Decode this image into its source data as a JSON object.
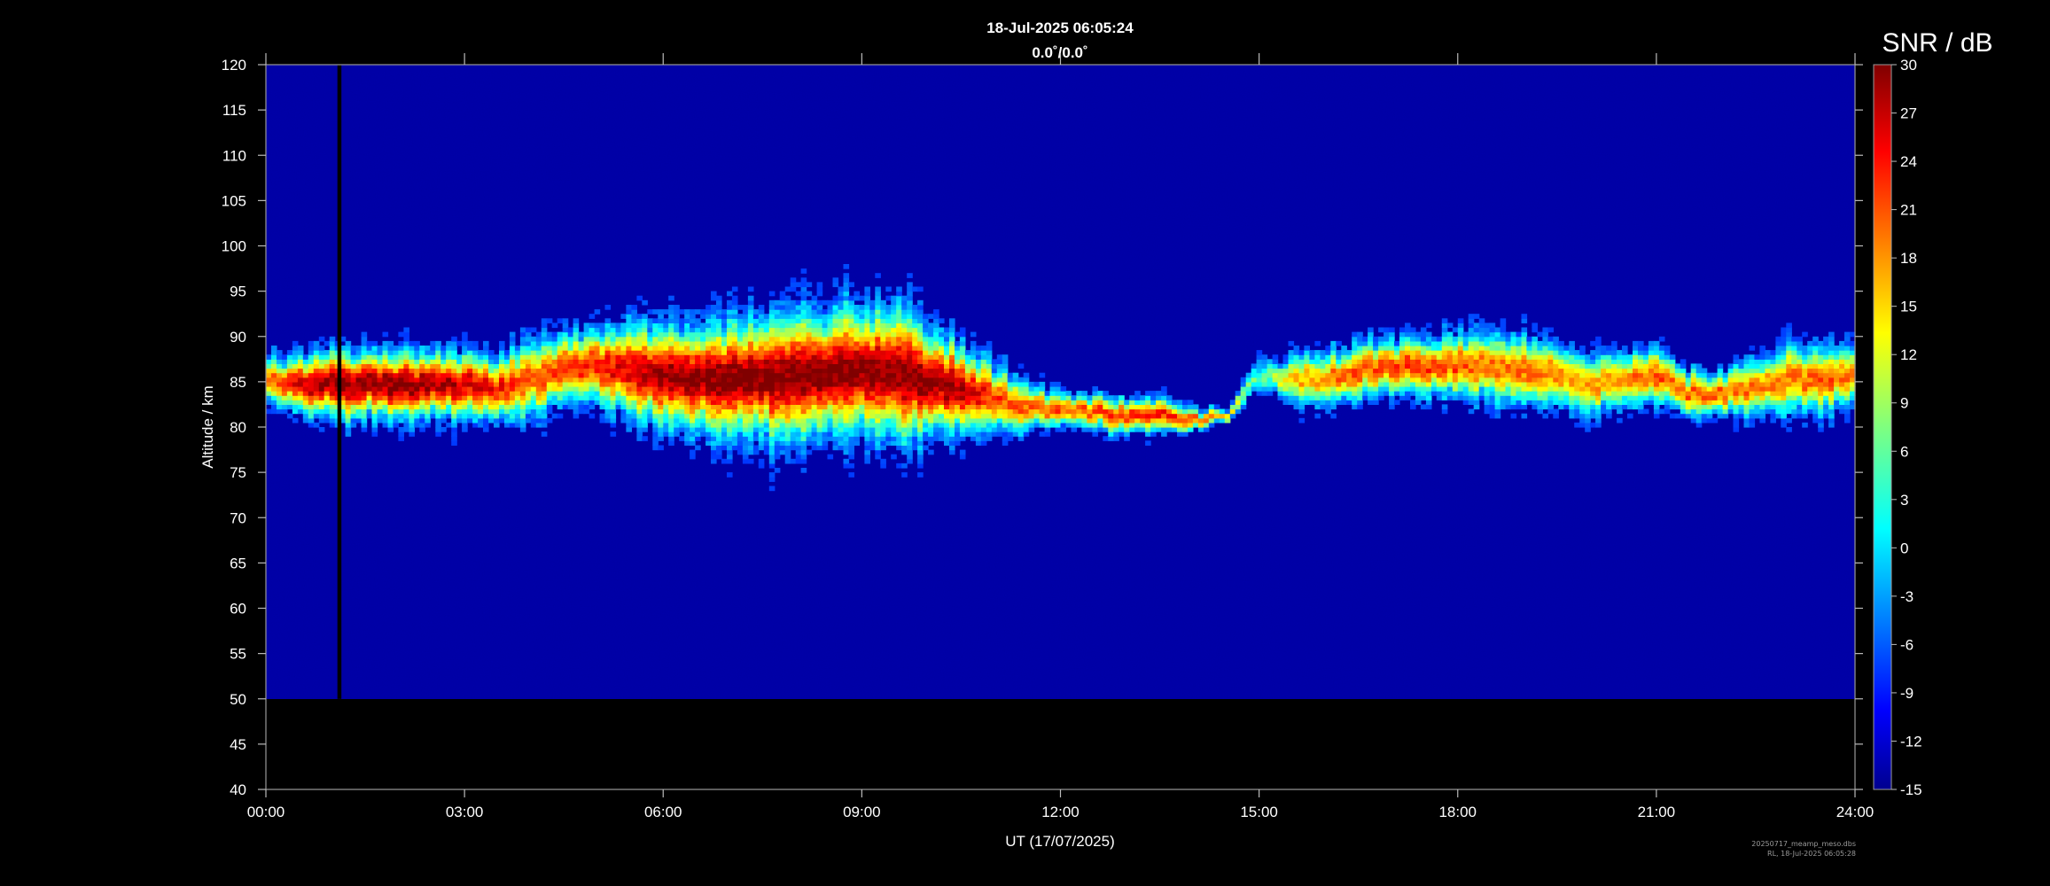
{
  "chart_data": {
    "type": "heatmap",
    "title": "18-Jul-2025 06:05:24",
    "subtitle": "0.0˚/0.0˚",
    "xlabel": "UT (17/07/2025)",
    "ylabel": "Altitude / km",
    "xlim": [
      "00:00",
      "24:00"
    ],
    "ylim": [
      40,
      120
    ],
    "x_ticks": [
      "00:00",
      "03:00",
      "06:00",
      "09:00",
      "12:00",
      "15:00",
      "18:00",
      "21:00",
      "24:00"
    ],
    "y_ticks": [
      "40",
      "45",
      "50",
      "55",
      "60",
      "65",
      "70",
      "75",
      "80",
      "85",
      "90",
      "95",
      "100",
      "105",
      "110",
      "115",
      "120"
    ],
    "data_altitude_range": [
      50,
      120
    ],
    "colorbar": {
      "label": "SNR / dB",
      "range": [
        -15,
        30
      ],
      "ticks": [
        "-15",
        "-12",
        "-9",
        "-6",
        "-3",
        "0",
        "3",
        "6",
        "9",
        "12",
        "15",
        "18",
        "21",
        "24",
        "27",
        "30"
      ],
      "colormap": "jet"
    },
    "background_snr": -11,
    "echo_layer": {
      "hours": [
        0,
        0.5,
        1,
        1.5,
        2,
        2.5,
        3,
        3.5,
        4,
        4.5,
        5,
        5.5,
        6,
        6.5,
        7,
        7.5,
        8,
        8.5,
        9,
        9.5,
        10,
        10.5,
        11,
        11.5,
        12,
        12.5,
        13,
        13.5,
        14,
        14.5,
        15,
        15.5,
        16,
        16.5,
        17,
        17.5,
        18,
        18.5,
        19,
        19.5,
        20,
        20.5,
        21,
        21.5,
        22,
        22.5,
        23,
        23.5,
        24
      ],
      "center_km": [
        85,
        84.5,
        84.5,
        84.5,
        84.5,
        84.5,
        84.5,
        84,
        85,
        86.5,
        86.5,
        86,
        85.5,
        85,
        85,
        85,
        85.5,
        85.5,
        86,
        85.5,
        85,
        84,
        83,
        82,
        81.5,
        81.5,
        81,
        81,
        80.5,
        81,
        85.5,
        85,
        85,
        86,
        86.5,
        86.5,
        86.5,
        86.5,
        86,
        85.5,
        84.5,
        85,
        85.5,
        83.5,
        83.5,
        84,
        85,
        85,
        85.5
      ],
      "half_width_km": [
        2,
        2.5,
        3,
        3,
        3,
        3,
        3,
        3,
        3.5,
        3,
        3.5,
        4,
        4.5,
        4.5,
        5,
        5.5,
        5.5,
        5.5,
        5.5,
        5.5,
        5,
        4,
        3,
        2,
        1.5,
        1.5,
        1.5,
        1.5,
        1,
        0.5,
        1.5,
        2,
        2.5,
        2.5,
        2.5,
        2.5,
        3,
        3,
        3,
        3,
        3,
        2.5,
        2.5,
        2,
        2,
        2.5,
        3,
        3,
        2.5
      ],
      "peak_snr": [
        18,
        26,
        29,
        30,
        30,
        29,
        27,
        24,
        21,
        22,
        24,
        26,
        29,
        30,
        30,
        30,
        30,
        30,
        30,
        30,
        30,
        28,
        22,
        20,
        21,
        21,
        23,
        24,
        21,
        16,
        4,
        16,
        18,
        21,
        22,
        22,
        21,
        19,
        20,
        19,
        17,
        19,
        21,
        20,
        20,
        19,
        19,
        21,
        18
      ]
    },
    "data_gap_hours": [
      1.08,
      1.14
    ]
  },
  "footer": {
    "line1": "20250717_meamp_meso.dbs",
    "line2": "RL, 18-Jul-2025 06:05:28"
  }
}
